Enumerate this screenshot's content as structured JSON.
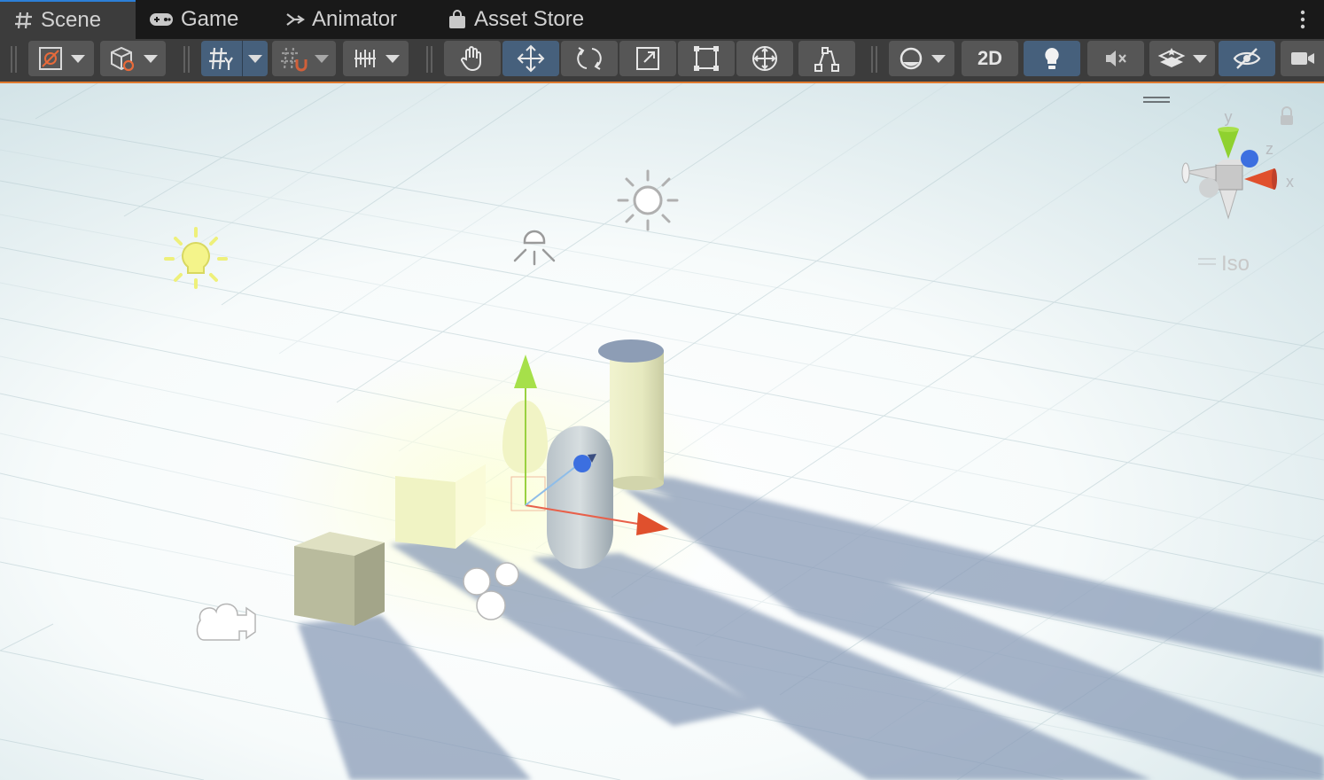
{
  "tabs": [
    {
      "label": "Scene",
      "icon": "hash-icon",
      "active": true
    },
    {
      "label": "Game",
      "icon": "gamepad-icon",
      "active": false
    },
    {
      "label": "Animator",
      "icon": "animator-icon",
      "active": false
    },
    {
      "label": "Asset Store",
      "icon": "shopping-bag-icon",
      "active": false
    }
  ],
  "toolbar": {
    "mode_2d_label": "2D",
    "tools": [
      "hand-tool",
      "move-tool",
      "rotate-tool",
      "scale-tool",
      "rect-tool",
      "transform-tool",
      "custom-tool"
    ],
    "active_tool": "move-tool"
  },
  "gizmo": {
    "axis_y": "y",
    "axis_z": "z",
    "axis_x": "x",
    "projection_label": "Iso"
  },
  "colors": {
    "accent": "#e07a2f",
    "tab_highlight": "#2c7fd7",
    "toggle_on": "#46607c",
    "axis_x": "#e0502d",
    "axis_y": "#8fd12f",
    "axis_z": "#3c6fe0"
  }
}
